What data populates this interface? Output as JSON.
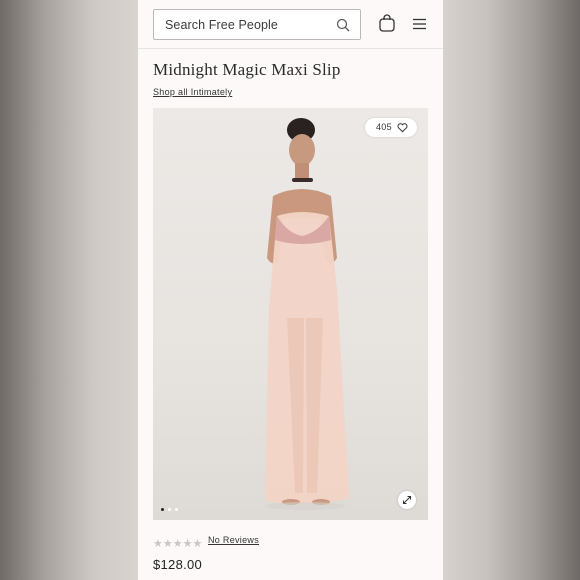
{
  "search": {
    "placeholder": "Search Free People"
  },
  "header": {
    "icons": [
      "search-icon",
      "shopping-bag-icon",
      "hamburger-menu-icon"
    ]
  },
  "product": {
    "title": "Midnight Magic Maxi Slip",
    "brand_link": "Shop all Intimately",
    "favorites_count": "405",
    "rating_stars": 0,
    "reviews_link": "No Reviews",
    "price": "$128.00"
  },
  "gallery": {
    "slide_count": 3,
    "active_slide": 1
  },
  "colors": {
    "accent": "#2b2b2b",
    "background": "#fcf9f8",
    "dress": "#f3d6c9"
  }
}
